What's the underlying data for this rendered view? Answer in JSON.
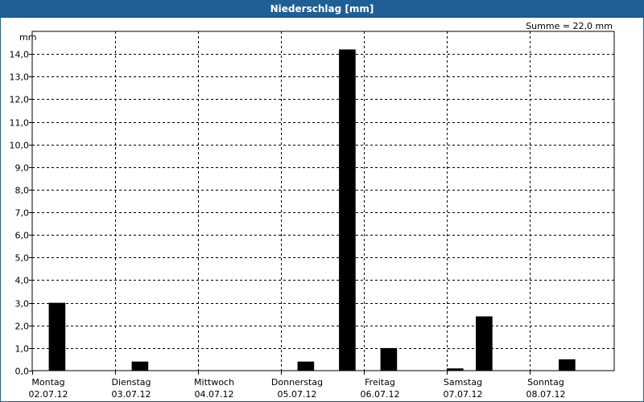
{
  "window": {
    "title": "Niederschlag [mm]"
  },
  "summary": {
    "text": "Summe = 22,0 mm"
  },
  "chart_data": {
    "type": "bar",
    "title": "Niederschlag [mm]",
    "unit_label": "mm",
    "ylim": [
      0,
      15
    ],
    "yticks": [
      "0,0",
      "1,0",
      "2,0",
      "3,0",
      "4,0",
      "5,0",
      "6,0",
      "7,0",
      "8,0",
      "9,0",
      "10,0",
      "11,0",
      "12,0",
      "13,0",
      "14,0"
    ],
    "grid": true,
    "days": [
      {
        "name": "Montag",
        "date": "02.07.12"
      },
      {
        "name": "Dienstag",
        "date": "03.07.12"
      },
      {
        "name": "Mittwoch",
        "date": "04.07.12"
      },
      {
        "name": "Donnerstag",
        "date": "05.07.12"
      },
      {
        "name": "Freitag",
        "date": "06.07.12"
      },
      {
        "name": "Samstag",
        "date": "07.07.12"
      },
      {
        "name": "Sonntag",
        "date": "08.07.12"
      }
    ],
    "bar_width_days": 0.2,
    "bars": [
      {
        "x_day": 0.3,
        "value": 3.0
      },
      {
        "x_day": 1.3,
        "value": 0.4
      },
      {
        "x_day": 3.3,
        "value": 0.4
      },
      {
        "x_day": 3.8,
        "value": 14.2
      },
      {
        "x_day": 4.3,
        "value": 1.0
      },
      {
        "x_day": 5.1,
        "value": 0.1
      },
      {
        "x_day": 5.45,
        "value": 2.4
      },
      {
        "x_day": 6.45,
        "value": 0.5
      }
    ],
    "sum": "22,0"
  }
}
